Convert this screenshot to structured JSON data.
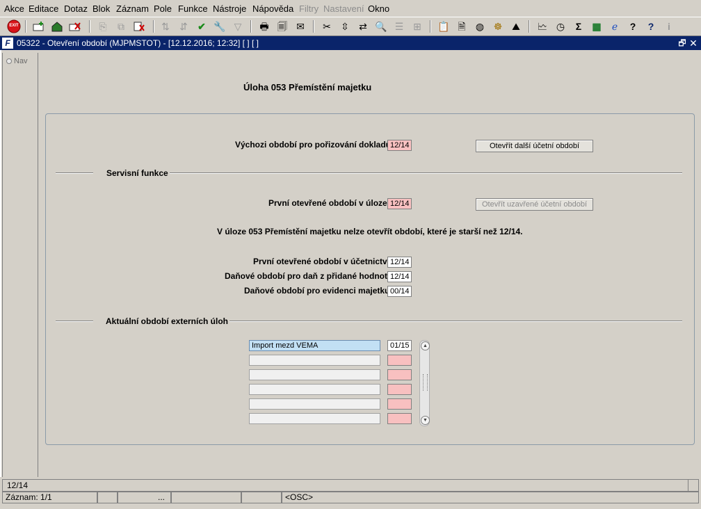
{
  "menu": [
    {
      "label": "Akce",
      "disabled": false
    },
    {
      "label": "Editace",
      "disabled": false
    },
    {
      "label": "Dotaz",
      "disabled": false
    },
    {
      "label": "Blok",
      "disabled": false
    },
    {
      "label": "Záznam",
      "disabled": false
    },
    {
      "label": "Pole",
      "disabled": false
    },
    {
      "label": "Funkce",
      "disabled": false
    },
    {
      "label": "Nástroje",
      "disabled": false
    },
    {
      "label": "Nápověda",
      "disabled": false
    },
    {
      "label": "Filtry",
      "disabled": true
    },
    {
      "label": "Nastavení",
      "disabled": true
    },
    {
      "label": "Okno",
      "disabled": false
    }
  ],
  "toolbar": {
    "exit_label": "EXIT"
  },
  "window": {
    "title": "05322 - Otevření období (MJPMSTOT) - [12.12.2016; 12:32]  [ ]  [ ]",
    "restore_glyph": "🗗",
    "close_glyph": "✕"
  },
  "nav": {
    "label": "Nav"
  },
  "form": {
    "heading": "Úloha  053 Přemístění majetku",
    "default_period_label": "Výchozi období pro pořizování dokladů",
    "default_period_value": "12/14",
    "open_next_button": "Otevřít další účetní období",
    "service_group_title": "Servisní funkce",
    "first_open_task_label": "První otevřené období v úloze",
    "first_open_task_value": "12/14",
    "open_closed_button": "Otevřít uzavřené účetní období",
    "info_message": "V úloze 053 Přemístění majetku nelze otevřít období, které je starší než 12/14.",
    "first_open_accounting_label": "První otevřené období v účetnictví",
    "first_open_accounting_value": "12/14",
    "vat_period_label": "Daňové období pro daň z přidané hodnoty",
    "vat_period_value": "12/14",
    "asset_tax_period_label": "Daňové období pro evidenci majetku",
    "asset_tax_period_value": "00/14",
    "external_group_title": "Aktuální období externích úloh",
    "external_rows": [
      {
        "name": "Import mezd VEMA",
        "period": "01/15"
      },
      {
        "name": "",
        "period": ""
      },
      {
        "name": "",
        "period": ""
      },
      {
        "name": "",
        "period": ""
      },
      {
        "name": "",
        "period": ""
      },
      {
        "name": "",
        "period": ""
      }
    ]
  },
  "status": {
    "message": "12/14",
    "record": "Záznam: 1/1",
    "ellipsis": "...",
    "mode": "<OSC>"
  }
}
